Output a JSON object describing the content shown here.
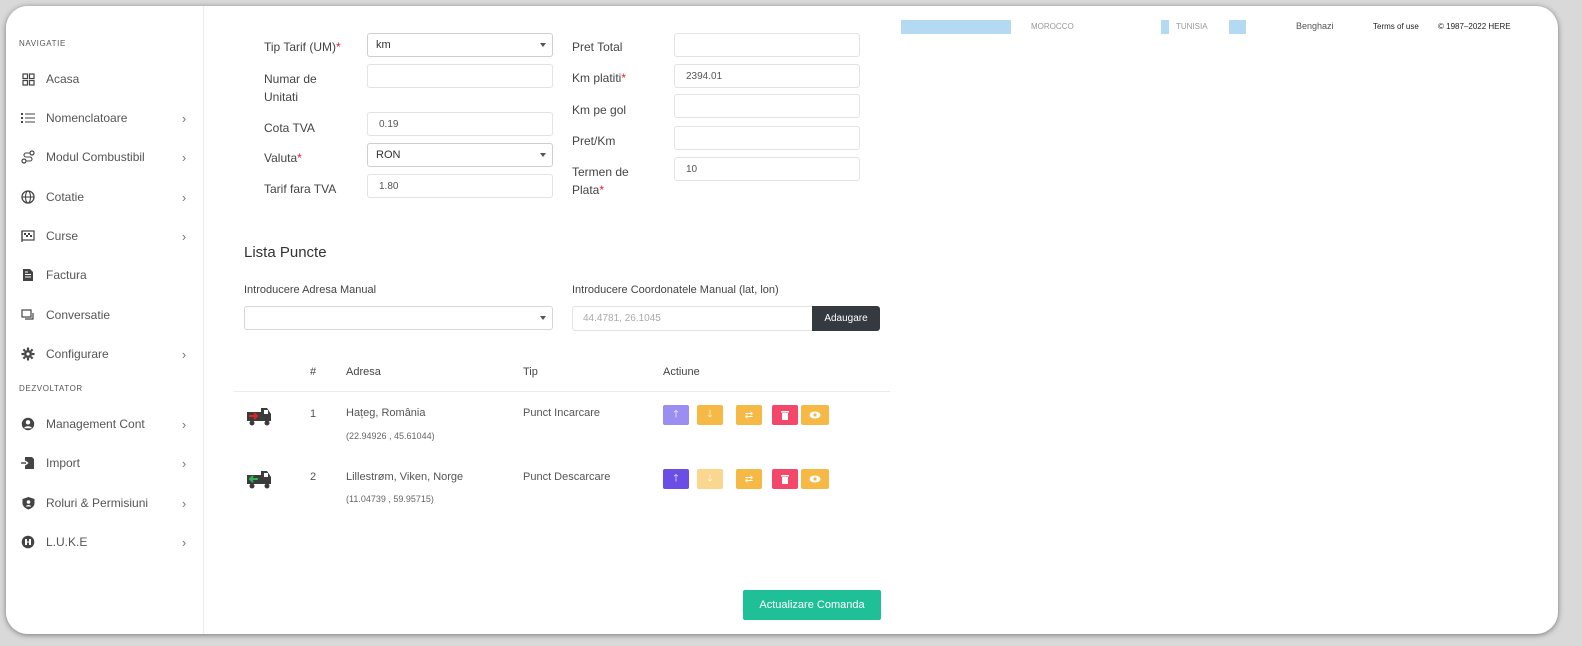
{
  "sidebar": {
    "section_navigation": "NAVIGATIE",
    "section_developer": "DEZVOLTATOR",
    "items": [
      {
        "label": "Acasa",
        "icon": "dashboard-icon",
        "chevron": false
      },
      {
        "label": "Nomenclatoare",
        "icon": "list-icon",
        "chevron": true
      },
      {
        "label": "Modul Combustibil",
        "icon": "route-icon",
        "chevron": true
      },
      {
        "label": "Cotatie",
        "icon": "globe-icon",
        "chevron": true
      },
      {
        "label": "Curse",
        "icon": "flag-icon",
        "chevron": true
      },
      {
        "label": "Factura",
        "icon": "invoice-icon",
        "chevron": false
      },
      {
        "label": "Conversatie",
        "icon": "chat-icon",
        "chevron": false
      },
      {
        "label": "Configurare",
        "icon": "gear-icon",
        "chevron": true
      }
    ],
    "dev_items": [
      {
        "label": "Management Cont",
        "icon": "user-icon",
        "chevron": true
      },
      {
        "label": "Import",
        "icon": "import-icon",
        "chevron": true
      },
      {
        "label": "Roluri & Permisiuni",
        "icon": "shield-icon",
        "chevron": true
      },
      {
        "label": "L.U.K.E",
        "icon": "robot-icon",
        "chevron": true
      }
    ],
    "chevron_glyph": "›"
  },
  "form": {
    "tip_tarif_label": "Tip Tarif (UM)",
    "tip_tarif_value": "km",
    "numar_unitati_label_1": "Numar de",
    "numar_unitati_label_2": "Unitati",
    "numar_unitati_value": "",
    "cota_tva_label": "Cota TVA",
    "cota_tva_value": "0.19",
    "valuta_label": "Valuta",
    "valuta_value": "RON",
    "tarif_fara_tva_label": "Tarif fara TVA",
    "tarif_fara_tva_value": "1.80",
    "pret_total_label": "Pret Total",
    "pret_total_value": "",
    "km_platiti_label": "Km platiti",
    "km_platiti_value": "2394.01",
    "km_pe_gol_label": "Km pe gol",
    "km_pe_gol_value": "",
    "pret_km_label": "Pret/Km",
    "pret_km_value": "",
    "termen_label_1": "Termen de",
    "termen_label_2": "Plata",
    "termen_value": "10",
    "required_mark": "*"
  },
  "points": {
    "title": "Lista Puncte",
    "address_label": "Introducere Adresa Manual",
    "address_value": "",
    "coords_label": "Introducere Coordonatele Manual (lat, lon)",
    "coords_placeholder": "44.4781, 26.1045",
    "add_button": "Adaugare",
    "headers": {
      "num": "#",
      "address": "Adresa",
      "type": "Tip",
      "action": "Actiune"
    },
    "rows": [
      {
        "num": "1",
        "address": "Hațeg, România",
        "coords": "(22.94926 , 45.61044)",
        "type": "Punct Incarcare"
      },
      {
        "num": "2",
        "address": "Lillestrøm, Viken, Norge",
        "coords": "(11.04739 , 59.95715)",
        "type": "Punct Descarcare"
      }
    ]
  },
  "update_button": "Actualizare Comanda",
  "map": {
    "label_morocco": "MOROCCO",
    "label_tunisia": "TUNISIA",
    "label_benghazi": "Benghazi",
    "terms": "Terms of use",
    "copyright": "© 1987–2022 HERE"
  },
  "colors": {
    "accent_green": "#1fbf97",
    "dark_button": "#343a40",
    "required": "#e0202a"
  }
}
